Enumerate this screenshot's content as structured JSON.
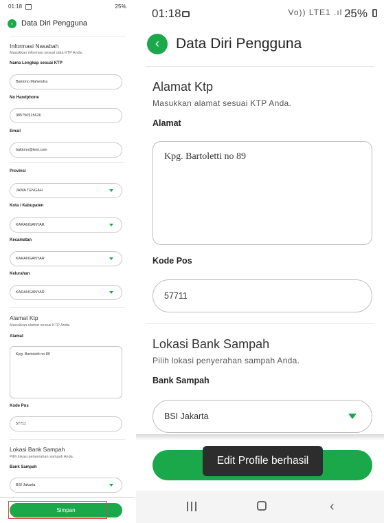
{
  "left": {
    "status": {
      "time": "01:18",
      "right": "25%"
    },
    "header": {
      "title": "Data Diri Pengguna"
    },
    "info_section": {
      "title": "Informasi Nasabah",
      "subtitle": "Masukkan informasi sesuai data KTP Anda."
    },
    "fields": {
      "nama_label": "Nama Lengkap sesuai KTP",
      "nama_value": "Bakiono Mahendra",
      "hp_label": "No Handphone",
      "hp_value": "085750515626",
      "email_label": "Email",
      "email_value": "bakiono@test.com",
      "provinsi_label": "Provinsi",
      "provinsi_value": "JAWA TENGAH",
      "kota_label": "Kota / Kabupaten",
      "kota_value": "KARANGANYAR",
      "kecamatan_label": "Kecamatan",
      "kecamatan_value": "KARANGANYAR",
      "kelurahan_label": "Kelurahan",
      "kelurahan_value": "KARANGANYAR"
    },
    "address_section": {
      "title": "Alamat Ktp",
      "subtitle": "Masukkan alamat sesuai KTP Anda.",
      "alamat_label": "Alamat",
      "alamat_value": "Kpg. Bartoletti no 89",
      "kodepos_label": "Kode Pos",
      "kodepos_value": "57711"
    },
    "bank_section": {
      "title": "Lokasi Bank Sampah",
      "subtitle": "Pilih lokasi penyerahan sampah Anda.",
      "bank_label": "Bank Sampah",
      "bank_value": "BSI Jakarta"
    },
    "save_label": "Simpan"
  },
  "right": {
    "status": {
      "time": "01:18",
      "network": "Vo)) LTE1 .ıl .ıl",
      "battery": "25%"
    },
    "header": {
      "title": "Data Diri Pengguna"
    },
    "address_section": {
      "title": "Alamat Ktp",
      "subtitle": "Masukkan alamat sesuai KTP Anda.",
      "alamat_label": "Alamat",
      "alamat_value": "Kpg. Bartoletti no 89",
      "kodepos_label": "Kode Pos",
      "kodepos_value": "57711"
    },
    "bank_section": {
      "title": "Lokasi Bank Sampah",
      "subtitle": "Pilih lokasi penyerahan sampah Anda.",
      "bank_label": "Bank Sampah",
      "bank_value": "BSI Jakarta"
    },
    "toast": "Edit Profile berhasil",
    "nav": {
      "recent": "recent-apps-icon",
      "home": "home-icon",
      "back": "back-icon"
    }
  },
  "colors": {
    "accent": "#1aa84b",
    "toast_bg": "#2d2d2d"
  }
}
